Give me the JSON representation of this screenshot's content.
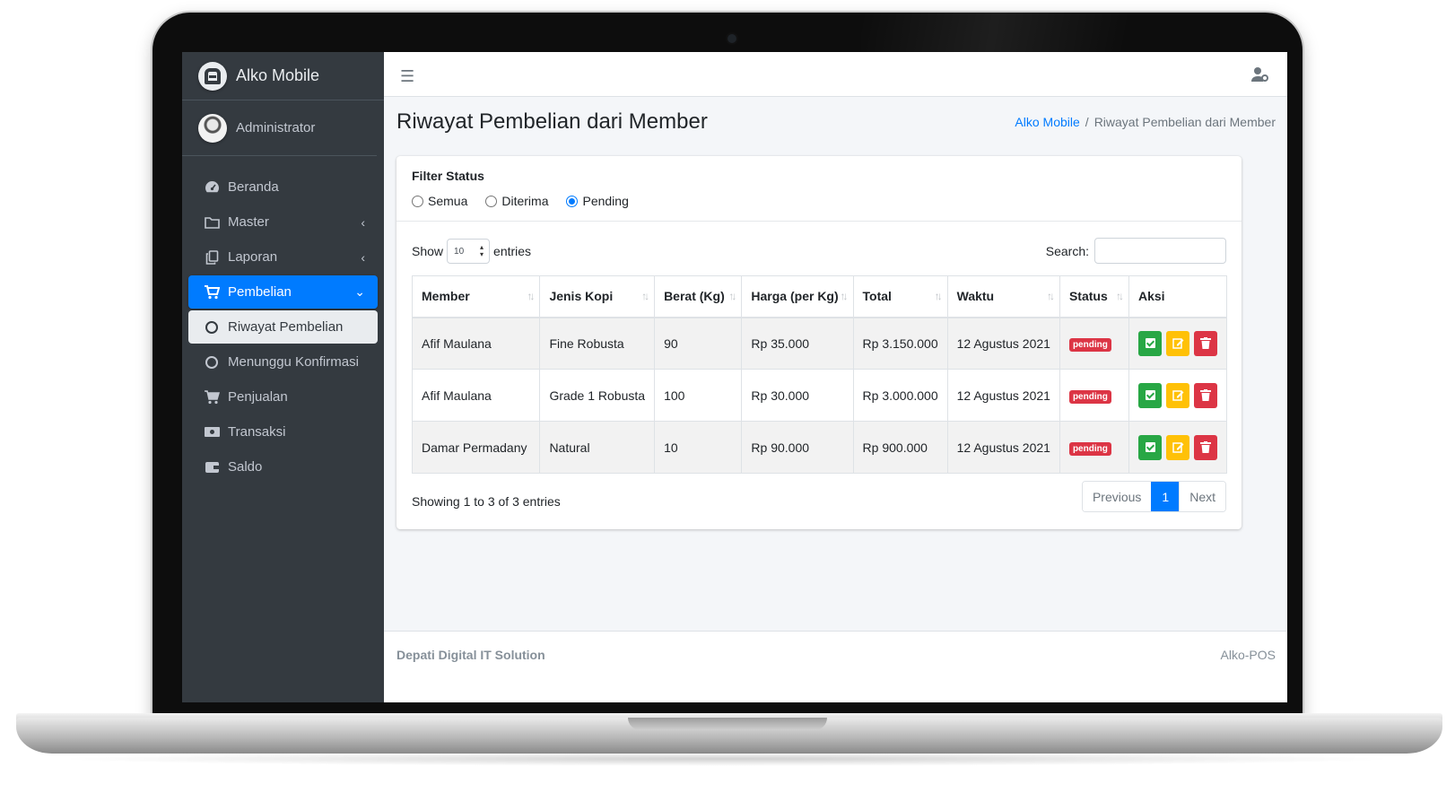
{
  "brand": {
    "name": "Alko Mobile"
  },
  "user": {
    "name": "Administrator"
  },
  "sidebar": {
    "items": [
      {
        "label": "Beranda",
        "icon": "tachometer-icon"
      },
      {
        "label": "Master",
        "icon": "folder-icon"
      },
      {
        "label": "Laporan",
        "icon": "copy-icon"
      },
      {
        "label": "Pembelian",
        "icon": "cart-icon"
      },
      {
        "label": "Riwayat Pembelian",
        "icon": "circle-icon"
      },
      {
        "label": "Menunggu Konfirmasi",
        "icon": "circle-icon"
      },
      {
        "label": "Penjualan",
        "icon": "cart-icon"
      },
      {
        "label": "Transaksi",
        "icon": "money-icon"
      },
      {
        "label": "Saldo",
        "icon": "wallet-icon"
      }
    ]
  },
  "header": {
    "title": "Riwayat Pembelian dari Member",
    "breadcrumb": [
      "Alko Mobile",
      "/",
      "Riwayat Pembelian dari Member"
    ]
  },
  "filter": {
    "title": "Filter Status",
    "options": [
      "Semua",
      "Diterima",
      "Pending"
    ],
    "selected": "Pending"
  },
  "datatable": {
    "show_label": "Show",
    "length_value": "10",
    "entries_label": "entries",
    "search_label": "Search:",
    "search_value": "",
    "columns": [
      "Member",
      "Jenis Kopi",
      "Berat (Kg)",
      "Harga (per Kg)",
      "Total",
      "Waktu",
      "Status",
      "Aksi"
    ],
    "rows": [
      [
        "Afif Maulana",
        "Fine Robusta",
        "90",
        "Rp 35.000",
        "Rp 3.150.000",
        "12 Agustus 2021",
        "pending"
      ],
      [
        "Afif Maulana",
        "Grade 1 Robusta",
        "100",
        "Rp 30.000",
        "Rp 3.000.000",
        "12 Agustus 2021",
        "pending"
      ],
      [
        "Damar Permadany",
        "Natural",
        "10",
        "Rp 90.000",
        "Rp 900.000",
        "12 Agustus 2021",
        "pending"
      ]
    ],
    "info": "Showing 1 to 3 of 3 entries",
    "pagination": {
      "previous": "Previous",
      "current": "1",
      "next": "Next"
    }
  },
  "footer": {
    "left": "Depati Digital IT Solution",
    "right": "Alko-POS"
  },
  "colors": {
    "primary": "#007bff",
    "sidebar": "#343a40",
    "success": "#28a745",
    "warning": "#ffc107",
    "danger": "#dc3545"
  }
}
